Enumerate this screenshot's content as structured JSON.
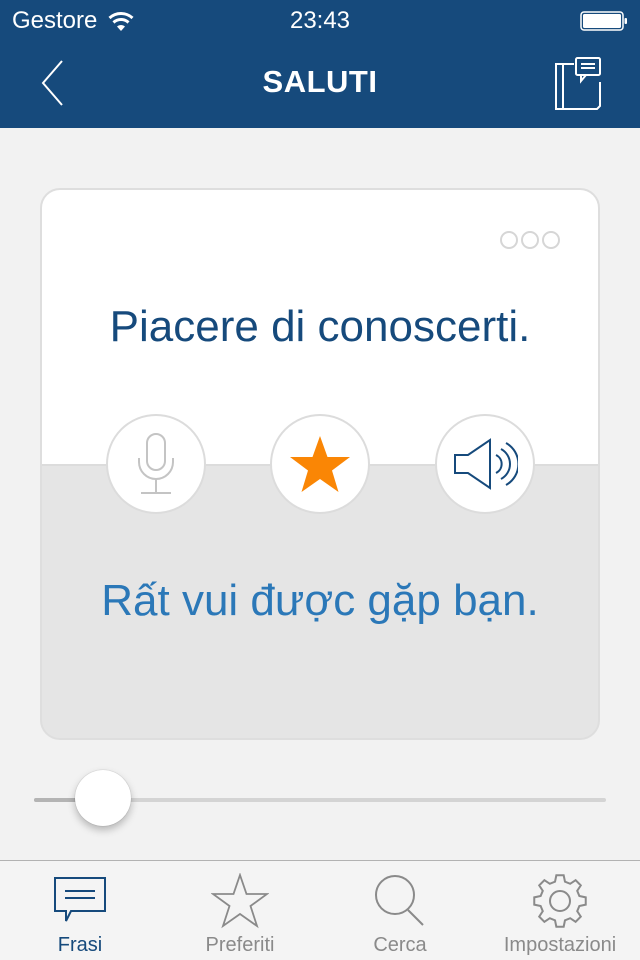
{
  "status_bar": {
    "carrier": "Gestore",
    "time": "23:43",
    "wifi_icon": "wifi-icon",
    "battery_icon": "battery-icon"
  },
  "nav": {
    "title": "SALUTI",
    "back_icon": "chevron-left-icon",
    "right_icon": "phrasebook-icon"
  },
  "card": {
    "menu_icon": "more-dots-icon",
    "phrase": "Piacere di conoscerti.",
    "translation": "Rất vui được gặp bạn.",
    "actions": [
      {
        "name": "record",
        "icon": "microphone-icon"
      },
      {
        "name": "favorite",
        "icon": "star-icon",
        "active": true
      },
      {
        "name": "play",
        "icon": "speaker-icon"
      }
    ]
  },
  "slider": {
    "value_fraction": 0.05
  },
  "tabbar": {
    "items": [
      {
        "label": "Frasi",
        "icon": "speech-bubble-icon",
        "active": true
      },
      {
        "label": "Preferiti",
        "icon": "star-outline-icon",
        "active": false
      },
      {
        "label": "Cerca",
        "icon": "search-icon",
        "active": false
      },
      {
        "label": "Impostazioni",
        "icon": "gear-icon",
        "active": false
      }
    ]
  },
  "colors": {
    "brand": "#164a7c",
    "accent_star": "#fa8605",
    "translation_text": "#2b78b8",
    "inactive_tab": "#8a8a8a"
  }
}
